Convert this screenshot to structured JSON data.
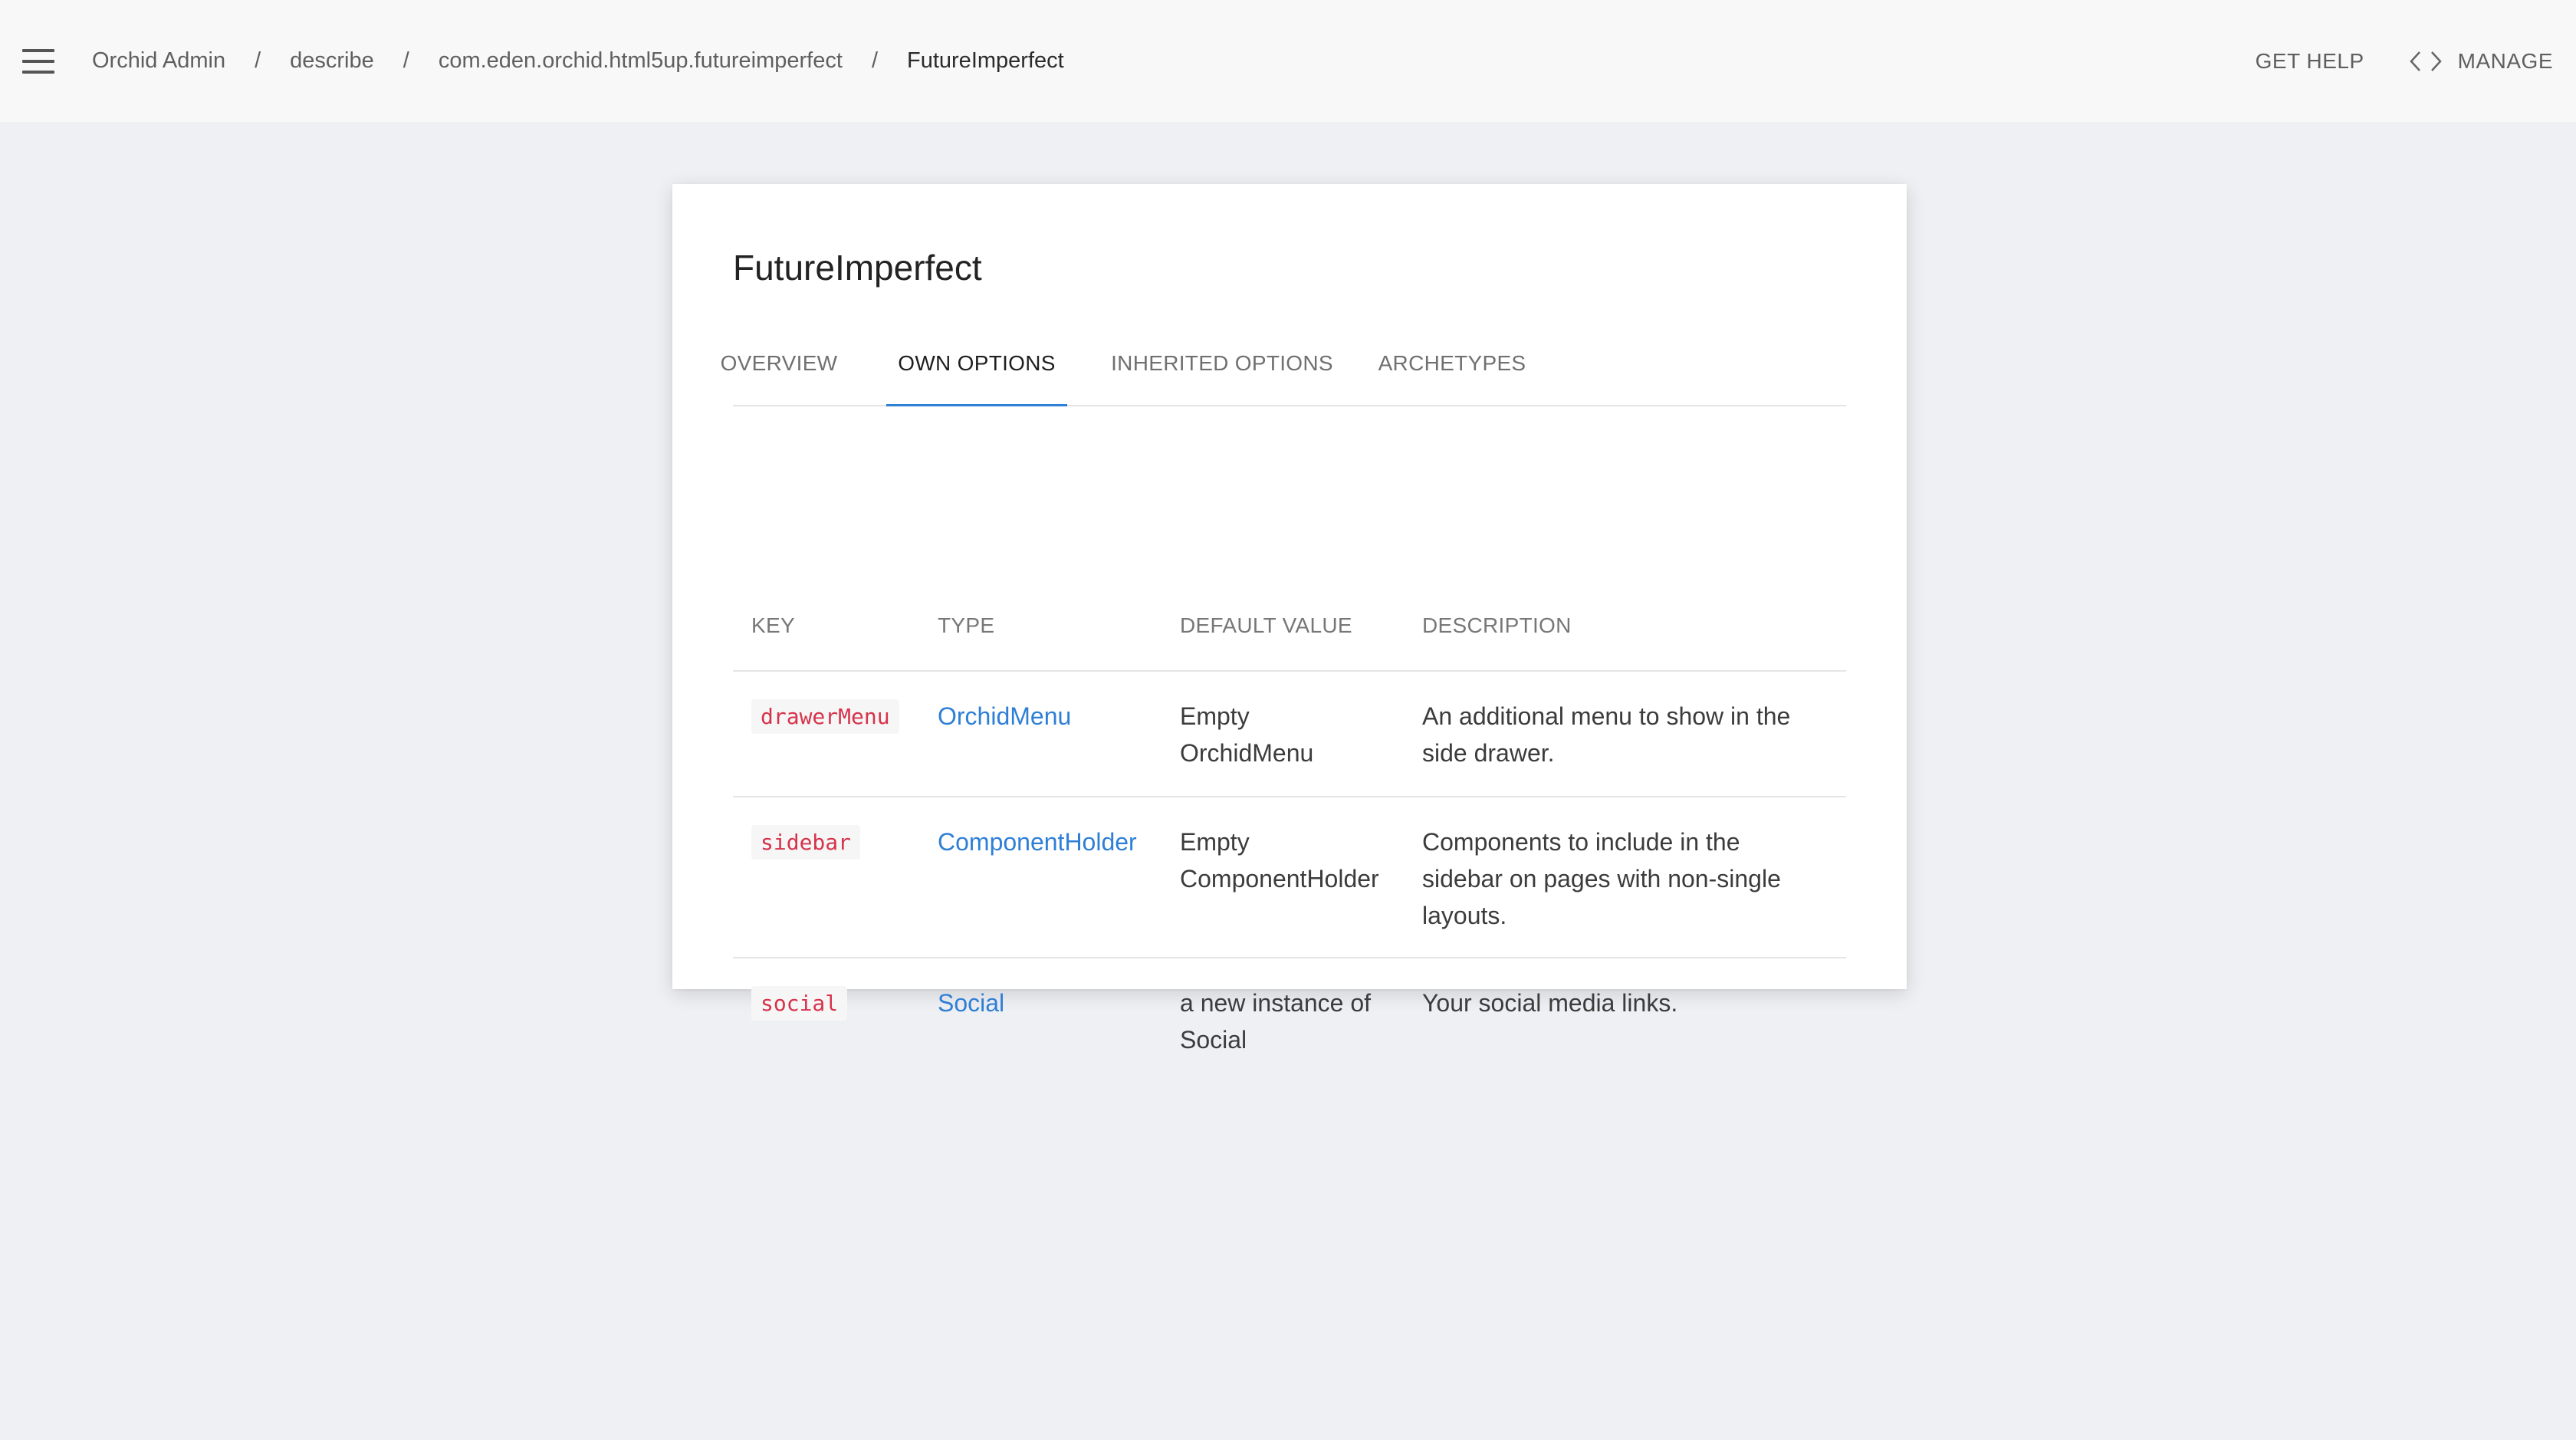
{
  "header": {
    "breadcrumb": [
      "Orchid Admin",
      "describe",
      "com.eden.orchid.html5up.futureimperfect",
      "FutureImperfect"
    ],
    "separator": "/",
    "get_help": "GET HELP",
    "manage": "MANAGE"
  },
  "card": {
    "title": "FutureImperfect",
    "tabs": [
      "OVERVIEW",
      "OWN OPTIONS",
      "INHERITED OPTIONS",
      "ARCHETYPES"
    ],
    "active_tab": "OWN OPTIONS"
  },
  "table": {
    "headers": [
      "KEY",
      "TYPE",
      "DEFAULT VALUE",
      "DESCRIPTION"
    ],
    "rows": [
      {
        "key": "drawerMenu",
        "type": "OrchidMenu",
        "default": [
          "Empty",
          "OrchidMenu"
        ],
        "description": [
          "An additional menu to show in the",
          "side drawer."
        ]
      },
      {
        "key": "sidebar",
        "type": "ComponentHolder",
        "default": [
          "Empty",
          "ComponentHolder"
        ],
        "description": [
          "Components to include in the",
          "sidebar on pages with non-single",
          "layouts."
        ]
      },
      {
        "key": "social",
        "type": "Social",
        "default": [
          "a new instance of",
          "Social"
        ],
        "description": [
          "Your social media links."
        ]
      }
    ]
  },
  "colors": {
    "accent": "#2e7fd6",
    "code": "#d6334b",
    "background": "#eff0f4"
  },
  "icons": [
    "menu-icon",
    "code-icon"
  ]
}
